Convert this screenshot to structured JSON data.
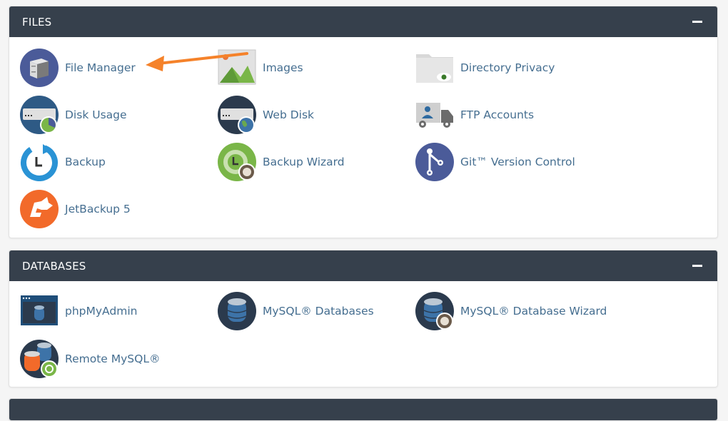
{
  "sections": [
    {
      "title": "FILES",
      "collapse_icon": "minus-icon",
      "items": [
        {
          "label": "File Manager",
          "icon": "file-cabinet-icon"
        },
        {
          "label": "Images",
          "icon": "image-icon"
        },
        {
          "label": "Directory Privacy",
          "icon": "folder-eye-icon"
        },
        {
          "label": "Disk Usage",
          "icon": "disk-usage-icon"
        },
        {
          "label": "Web Disk",
          "icon": "web-disk-icon"
        },
        {
          "label": "FTP Accounts",
          "icon": "ftp-truck-icon"
        },
        {
          "label": "Backup",
          "icon": "backup-icon"
        },
        {
          "label": "Backup Wizard",
          "icon": "backup-wizard-icon"
        },
        {
          "label": "Git™ Version Control",
          "icon": "git-icon"
        },
        {
          "label": "JetBackup 5",
          "icon": "jetbackup-icon"
        }
      ]
    },
    {
      "title": "DATABASES",
      "collapse_icon": "minus-icon",
      "items": [
        {
          "label": "phpMyAdmin",
          "icon": "phpmyadmin-icon"
        },
        {
          "label": "MySQL® Databases",
          "icon": "database-icon"
        },
        {
          "label": "MySQL® Database Wizard",
          "icon": "database-wizard-icon"
        },
        {
          "label": "Remote MySQL®",
          "icon": "remote-mysql-icon"
        }
      ]
    }
  ],
  "annotation": {
    "type": "arrow",
    "color": "#f5822a",
    "points_to": "File Manager"
  },
  "colors": {
    "header": "#36404c",
    "link": "#456e90",
    "background": "#f5f5f5"
  }
}
